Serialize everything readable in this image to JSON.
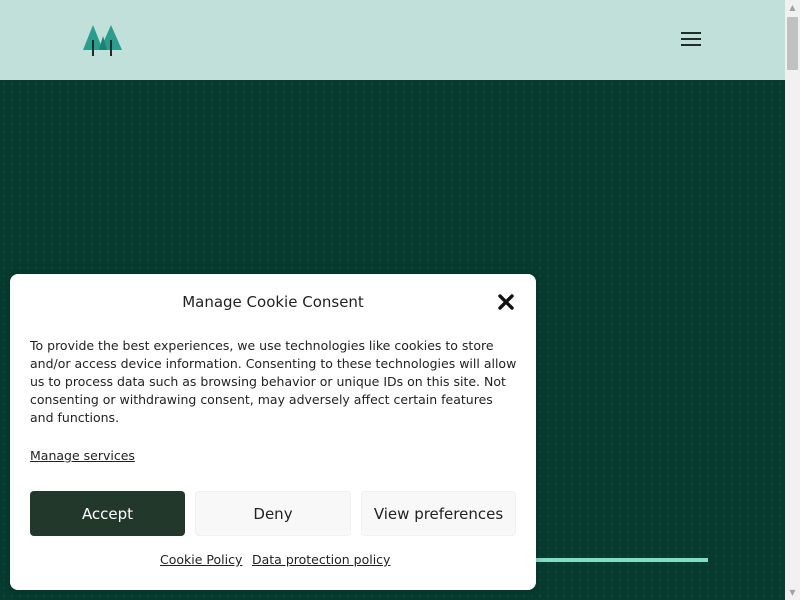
{
  "header": {
    "logo_icon": "pine-trees-logo-icon",
    "menu_icon": "hamburger-menu-icon"
  },
  "scrollbar": {
    "up_arrow": "▲",
    "down_arrow": "▼"
  },
  "cookie_banner": {
    "title": "Manage Cookie Consent",
    "close_icon": "close-icon",
    "message": "To provide the best experiences, we use technologies like cookies to store and/or access device information. Consenting to these technologies will allow us to process data such as browsing behavior or unique IDs on this site. Not consenting or withdrawing consent, may adversely affect certain features and functions.",
    "manage_services_label": "Manage services",
    "accept_label": "Accept",
    "deny_label": "Deny",
    "view_preferences_label": "View preferences",
    "cookie_policy_label": "Cookie Policy",
    "data_protection_label": "Data protection policy"
  },
  "colors": {
    "header_bg": "#c1e0d9",
    "hero_bg": "#073b30",
    "accent_line": "#7fe0c8",
    "accept_bg": "#22382b",
    "logo_teal": "#2a9d8f"
  }
}
